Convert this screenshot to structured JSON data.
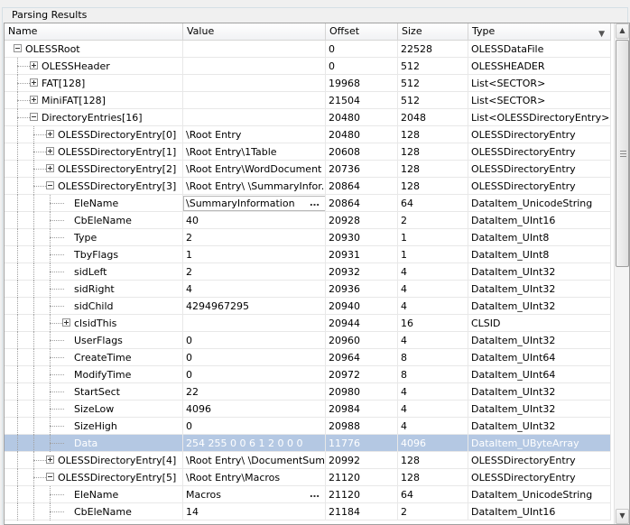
{
  "group_title": "Parsing Results",
  "columns": {
    "name": "Name",
    "value": "Value",
    "offset": "Offset",
    "size": "Size",
    "type": "Type"
  },
  "rows": [
    {
      "name": "OLESSRoot",
      "value": "",
      "offset": "0",
      "size": "22528",
      "type": "OLESSDataFile"
    },
    {
      "name": "OLESSHeader",
      "value": "",
      "offset": "0",
      "size": "512",
      "type": "OLESSHEADER"
    },
    {
      "name": "FAT[128]",
      "value": "",
      "offset": "19968",
      "size": "512",
      "type": "List<SECTOR>"
    },
    {
      "name": "MiniFAT[128]",
      "value": "",
      "offset": "21504",
      "size": "512",
      "type": "List<SECTOR>"
    },
    {
      "name": "DirectoryEntries[16]",
      "value": "",
      "offset": "20480",
      "size": "2048",
      "type": "List<OLESSDirectoryEntry>"
    },
    {
      "name": "OLESSDirectoryEntry[0]",
      "value": "\\Root Entry",
      "offset": "20480",
      "size": "128",
      "type": "OLESSDirectoryEntry"
    },
    {
      "name": "OLESSDirectoryEntry[1]",
      "value": "\\Root Entry\\1Table",
      "offset": "20608",
      "size": "128",
      "type": "OLESSDirectoryEntry"
    },
    {
      "name": "OLESSDirectoryEntry[2]",
      "value": "\\Root Entry\\WordDocument",
      "offset": "20736",
      "size": "128",
      "type": "OLESSDirectoryEntry"
    },
    {
      "name": "OLESSDirectoryEntry[3]",
      "value": "\\Root Entry\\ \\SummaryInfor...",
      "offset": "20864",
      "size": "128",
      "type": "OLESSDirectoryEntry"
    },
    {
      "name": "EleName",
      "value": "\\SummaryInformation",
      "offset": "20864",
      "size": "64",
      "type": "DataItem_UnicodeString"
    },
    {
      "name": "CbEleName",
      "value": "40",
      "offset": "20928",
      "size": "2",
      "type": "DataItem_UInt16"
    },
    {
      "name": "Type",
      "value": "2",
      "offset": "20930",
      "size": "1",
      "type": "DataItem_UInt8"
    },
    {
      "name": "TbyFlags",
      "value": "1",
      "offset": "20931",
      "size": "1",
      "type": "DataItem_UInt8"
    },
    {
      "name": "sidLeft",
      "value": "2",
      "offset": "20932",
      "size": "4",
      "type": "DataItem_UInt32"
    },
    {
      "name": "sidRight",
      "value": "4",
      "offset": "20936",
      "size": "4",
      "type": "DataItem_UInt32"
    },
    {
      "name": "sidChild",
      "value": "4294967295",
      "offset": "20940",
      "size": "4",
      "type": "DataItem_UInt32"
    },
    {
      "name": "clsidThis",
      "value": "",
      "offset": "20944",
      "size": "16",
      "type": "CLSID"
    },
    {
      "name": "UserFlags",
      "value": "0",
      "offset": "20960",
      "size": "4",
      "type": "DataItem_UInt32"
    },
    {
      "name": "CreateTime",
      "value": "0",
      "offset": "20964",
      "size": "8",
      "type": "DataItem_UInt64"
    },
    {
      "name": "ModifyTime",
      "value": "0",
      "offset": "20972",
      "size": "8",
      "type": "DataItem_UInt64"
    },
    {
      "name": "StartSect",
      "value": "22",
      "offset": "20980",
      "size": "4",
      "type": "DataItem_UInt32"
    },
    {
      "name": "SizeLow",
      "value": "4096",
      "offset": "20984",
      "size": "4",
      "type": "DataItem_UInt32"
    },
    {
      "name": "SizeHigh",
      "value": "0",
      "offset": "20988",
      "size": "4",
      "type": "DataItem_UInt32"
    },
    {
      "name": "Data",
      "value": "254 255 0 0 6 1 2 0 0 0",
      "offset": "11776",
      "size": "4096",
      "type": "DataItem_UByteArray"
    },
    {
      "name": "OLESSDirectoryEntry[4]",
      "value": "\\Root Entry\\ \\DocumentSum...",
      "offset": "20992",
      "size": "128",
      "type": "OLESSDirectoryEntry"
    },
    {
      "name": "OLESSDirectoryEntry[5]",
      "value": "\\Root Entry\\Macros",
      "offset": "21120",
      "size": "128",
      "type": "OLESSDirectoryEntry"
    },
    {
      "name": "EleName",
      "value": "Macros",
      "offset": "21120",
      "size": "64",
      "type": "DataItem_UnicodeString"
    },
    {
      "name": "CbEleName",
      "value": "14",
      "offset": "21184",
      "size": "2",
      "type": "DataItem_UInt16"
    }
  ],
  "selected_row": 23,
  "icons": {
    "expand": "plus-box-icon",
    "collapse": "minus-box-icon",
    "ellipsis": "ellipsis-icon",
    "scroll_up": "chevron-up-icon",
    "scroll_down": "chevron-down-icon"
  },
  "colors": {
    "selection": "#b4c8e3",
    "grid_line": "#e8e8e8"
  }
}
